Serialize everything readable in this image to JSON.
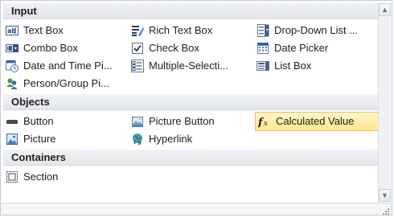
{
  "sections": [
    {
      "title": "Input",
      "items": [
        {
          "label": "Text Box",
          "icon": "text-box-icon"
        },
        {
          "label": "Rich Text Box",
          "icon": "rich-text-box-icon"
        },
        {
          "label": "Drop-Down List ...",
          "icon": "drop-down-list-icon"
        },
        {
          "label": "Combo Box",
          "icon": "combo-box-icon"
        },
        {
          "label": "Check Box",
          "icon": "check-box-icon"
        },
        {
          "label": "Date Picker",
          "icon": "date-picker-icon"
        },
        {
          "label": "Date and Time Pi...",
          "icon": "date-time-picker-icon"
        },
        {
          "label": "Multiple-Selecti...",
          "icon": "multiple-selection-list-icon"
        },
        {
          "label": "List Box",
          "icon": "list-box-icon"
        },
        {
          "label": "Person/Group Pi...",
          "icon": "person-group-picker-icon"
        }
      ]
    },
    {
      "title": "Objects",
      "items": [
        {
          "label": "Button",
          "icon": "button-icon"
        },
        {
          "label": "Picture Button",
          "icon": "picture-button-icon"
        },
        {
          "label": "Calculated Value",
          "icon": "calculated-value-icon",
          "selected": true
        },
        {
          "label": "Picture",
          "icon": "picture-icon"
        },
        {
          "label": "Hyperlink",
          "icon": "hyperlink-icon"
        }
      ]
    },
    {
      "title": "Containers",
      "items": [
        {
          "label": "Section",
          "icon": "section-icon"
        }
      ]
    }
  ],
  "scrollbar": {
    "up_glyph": "▲",
    "down_glyph": "▼"
  },
  "colors": {
    "selected_bg": "#ffe58f",
    "header_bg": "#e3e6ea",
    "border": "#c5cbd3"
  }
}
